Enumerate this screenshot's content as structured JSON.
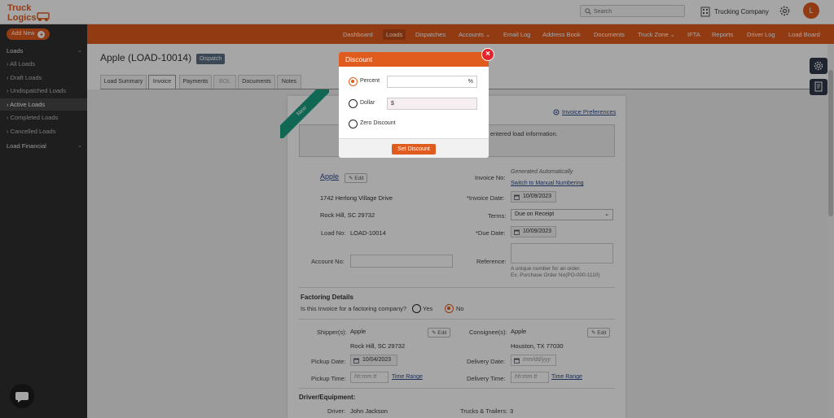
{
  "brand": {
    "logo_text": "Truck Logics",
    "accent": "#e05b1e"
  },
  "header": {
    "search_placeholder": "Search",
    "company": "Trucking Company",
    "avatar_initial": "L"
  },
  "sidebar": {
    "add_new": "Add New",
    "loads_section": "Loads",
    "items": [
      "All Loads",
      "Draft Loads",
      "Undispatched Loads",
      "Active Loads",
      "Completed Loads",
      "Cancelled Loads"
    ],
    "active_item": "Active Loads",
    "financial_section": "Load Financial"
  },
  "nav": [
    "Dashboard",
    "Loads",
    "Dispatches",
    "Accounts",
    "Email Log",
    "Address Book",
    "Documents",
    "Truck Zone",
    "IFTA",
    "Reports",
    "Driver Log",
    "Load Board"
  ],
  "nav_active": "Loads",
  "page": {
    "title": "Apple (LOAD-10014)",
    "badge": "Dispatch"
  },
  "tabs": [
    "Load Summary",
    "Invoice",
    "Payments",
    "BOL",
    "Documents",
    "Notes"
  ],
  "active_tab": "Invoice",
  "invoice": {
    "ribbon": "New",
    "preferences_link": "Invoice Preferences",
    "notice": "y entered load information.",
    "customer": "Apple",
    "edit": "Edit",
    "address1": "1742 Herlong Village Drive",
    "address2": "Rock Hill, SC 29732",
    "load_no_label": "Load No:",
    "load_no": "LOAD-10014",
    "account_no_label": "Account No:",
    "invoice_no_label": "Invoice No:",
    "invoice_no_value": "Generated Automatically",
    "manual_link": "Switch to Manual Numbering",
    "invoice_date_label": "*Invoice Date:",
    "invoice_date": "10/09/2023",
    "terms_label": "Terms:",
    "terms": "Due on Receipt",
    "due_date_label": "*Due Date:",
    "due_date": "10/09/2023",
    "reference_label": "Reference:",
    "reference_hint1": "A unique number for an order.",
    "reference_hint2": "Ex. Purchase Order No(PO-000-1110)",
    "factoring_title": "Factoring Details",
    "factoring_question": "Is this Invoice for a factoring company?",
    "yes": "Yes",
    "no": "No",
    "shipper_label": "Shipper(s):",
    "shipper": "Apple",
    "shipper_addr": "Rock Hill, SC 29732",
    "consignee_label": "Consignee(s):",
    "consignee": "Apple",
    "consignee_addr": "Houston, TX 77030",
    "pickup_date_label": "Pickup Date:",
    "pickup_date": "10/04/2023",
    "delivery_date_label": "Delivery Date:",
    "delivery_date_placeholder": "mm/dd/yyy",
    "pickup_time_label": "Pickup Time:",
    "delivery_time_label": "Delivery Time:",
    "time_placeholder": "hh:mm tt",
    "time_range": "Time Range",
    "driver_title": "Driver/Equipment:",
    "driver_label": "Driver:",
    "driver": "John Jackson",
    "trucks_label": "Trucks & Trailers:",
    "trucks": "3"
  },
  "modal": {
    "title": "Discount",
    "percent_label": "Percent",
    "percent_suffix": "%",
    "dollar_label": "Dollar",
    "dollar_prefix": "$",
    "zero_label": "Zero Discount",
    "selected": "Percent",
    "button": "Set Discount"
  }
}
